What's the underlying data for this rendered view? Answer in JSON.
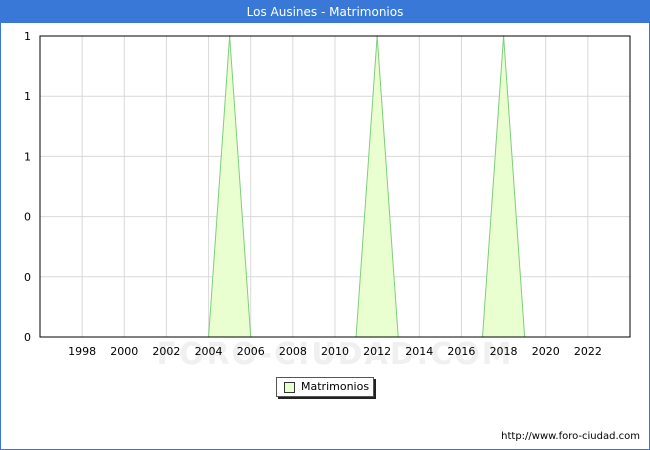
{
  "header": {
    "title": "Los Ausines - Matrimonios"
  },
  "watermark": "FORO-CIUDAD.COM",
  "legend": {
    "label": "Matrimonios"
  },
  "footer": {
    "source_url": "http://www.foro-ciudad.com"
  },
  "colors": {
    "title_bar": "#3a78d8",
    "area_fill": "#eaffcf",
    "area_line": "#7ccf7c",
    "grid": "#d9d9d9"
  },
  "chart_data": {
    "type": "area",
    "title": "Los Ausines - Matrimonios",
    "xlabel": "",
    "ylabel": "",
    "xlim": [
      1996,
      2024
    ],
    "ylim": [
      0,
      1
    ],
    "x_ticks": [
      1998,
      2000,
      2002,
      2004,
      2006,
      2008,
      2010,
      2012,
      2014,
      2016,
      2018,
      2020,
      2022
    ],
    "y_ticks": [
      {
        "value": 0,
        "label": "0"
      },
      {
        "value": 0.2,
        "label": "0"
      },
      {
        "value": 0.4,
        "label": "0"
      },
      {
        "value": 0.6,
        "label": "1"
      },
      {
        "value": 0.8,
        "label": "1"
      },
      {
        "value": 1.0,
        "label": "1"
      }
    ],
    "grid": true,
    "legend_position": "bottom-center",
    "series": [
      {
        "name": "Matrimonios",
        "x": [
          1996,
          1997,
          1998,
          1999,
          2000,
          2001,
          2002,
          2003,
          2004,
          2005,
          2006,
          2007,
          2008,
          2009,
          2010,
          2011,
          2012,
          2013,
          2014,
          2015,
          2016,
          2017,
          2018,
          2019,
          2020,
          2021,
          2022,
          2023
        ],
        "values": [
          0,
          0,
          0,
          0,
          0,
          0,
          0,
          0,
          0,
          1,
          0,
          0,
          0,
          0,
          0,
          0,
          1,
          0,
          0,
          0,
          0,
          0,
          1,
          0,
          0,
          0,
          0,
          0
        ]
      }
    ]
  }
}
